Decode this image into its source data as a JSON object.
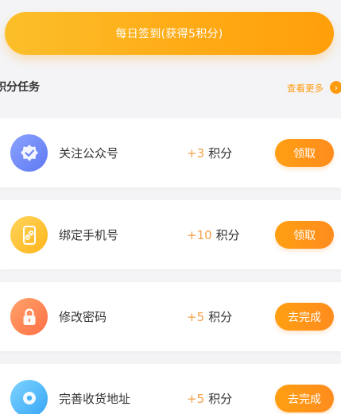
{
  "signin": {
    "label": "每日签到(获得5积分)"
  },
  "section": {
    "title": "积分任务",
    "see_more": "查看更多"
  },
  "tasks": [
    {
      "name": "关注公众号",
      "points": "+3",
      "unit": "积分",
      "button": "领取",
      "icon": "badge-check-icon",
      "color": "#6f87f7"
    },
    {
      "name": "绑定手机号",
      "points": "+10",
      "unit": "积分",
      "button": "领取",
      "icon": "phone-link-icon",
      "color": "#ffbe2e"
    },
    {
      "name": "修改密码",
      "points": "+5",
      "unit": "积分",
      "button": "去完成",
      "icon": "lock-icon",
      "color": "#ff7e50"
    },
    {
      "name": "完善收货地址",
      "points": "+5",
      "unit": "积分",
      "button": "去完成",
      "icon": "location-pin-icon",
      "color": "#48b2f7"
    }
  ],
  "colors": {
    "accent": "#ff9b0e",
    "points": "#f5a04a",
    "background": "#f4f4f6"
  }
}
